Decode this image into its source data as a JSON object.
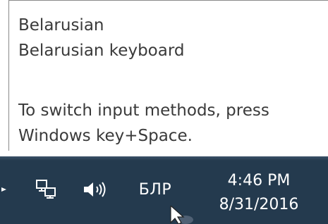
{
  "tooltip": {
    "language": "Belarusian",
    "keyboard": "Belarusian keyboard",
    "hint_line1": "To switch input methods, press",
    "hint_line2": "Windows key+Space."
  },
  "taskbar": {
    "background_color": "#243a4e",
    "show_hidden_icons": "chevron-left-icon",
    "network_icon": "network-icon",
    "volume_icon": "volume-icon",
    "input_language": "БЛР",
    "time": "4:46 PM",
    "date": "8/31/2016"
  }
}
